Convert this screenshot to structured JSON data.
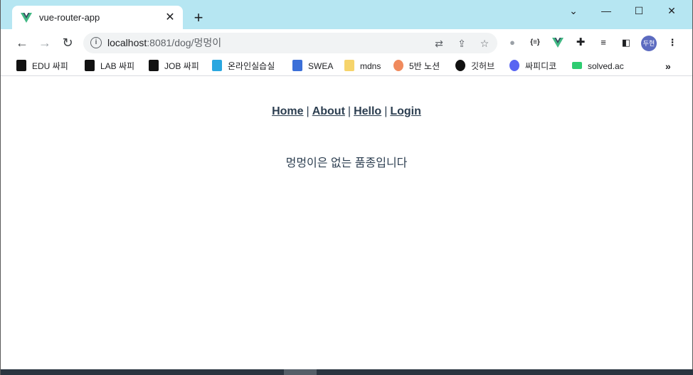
{
  "tab": {
    "title": "vue-router-app",
    "favicon": "vue-logo-icon"
  },
  "window_controls": {
    "dropdown": "⌄",
    "minimize": "—",
    "maximize": "☐",
    "close": "✕"
  },
  "address": {
    "host": "localhost",
    "path": ":8081/dog/멍멍이"
  },
  "bookmarks": [
    {
      "label": "EDU 싸피",
      "icon": "ssafy-icon",
      "color": "#111111"
    },
    {
      "label": "LAB 싸피",
      "icon": "ssafy-icon",
      "color": "#111111"
    },
    {
      "label": "JOB 싸피",
      "icon": "ssafy-icon",
      "color": "#111111"
    },
    {
      "label": "온라인실습실",
      "icon": "ssafy-online-icon",
      "color": "#2aa7e0"
    },
    {
      "label": "SWEA",
      "icon": "swea-icon",
      "color": "#3b6fd8"
    },
    {
      "label": "mdns",
      "icon": "folder-icon",
      "color": "#f6d46b"
    },
    {
      "label": "5반 노션",
      "icon": "peach-icon",
      "color": "#f08a5d"
    },
    {
      "label": "깃허브",
      "icon": "github-icon",
      "color": "#111111"
    },
    {
      "label": "싸피디코",
      "icon": "discord-icon",
      "color": "#5865f2"
    },
    {
      "label": "solved.ac",
      "icon": "solved-ac-icon",
      "color": "#2ecc71"
    }
  ],
  "page": {
    "nav": {
      "home": "Home",
      "about": "About",
      "hello": "Hello",
      "login": "Login",
      "separator": "|"
    },
    "message": "멍멍이은 없는 품종입니다"
  },
  "profile": {
    "initials": "두현"
  },
  "colors": {
    "tabstrip": "#b6e6f2",
    "text": "#2c3e50",
    "vue": "#41b883"
  }
}
